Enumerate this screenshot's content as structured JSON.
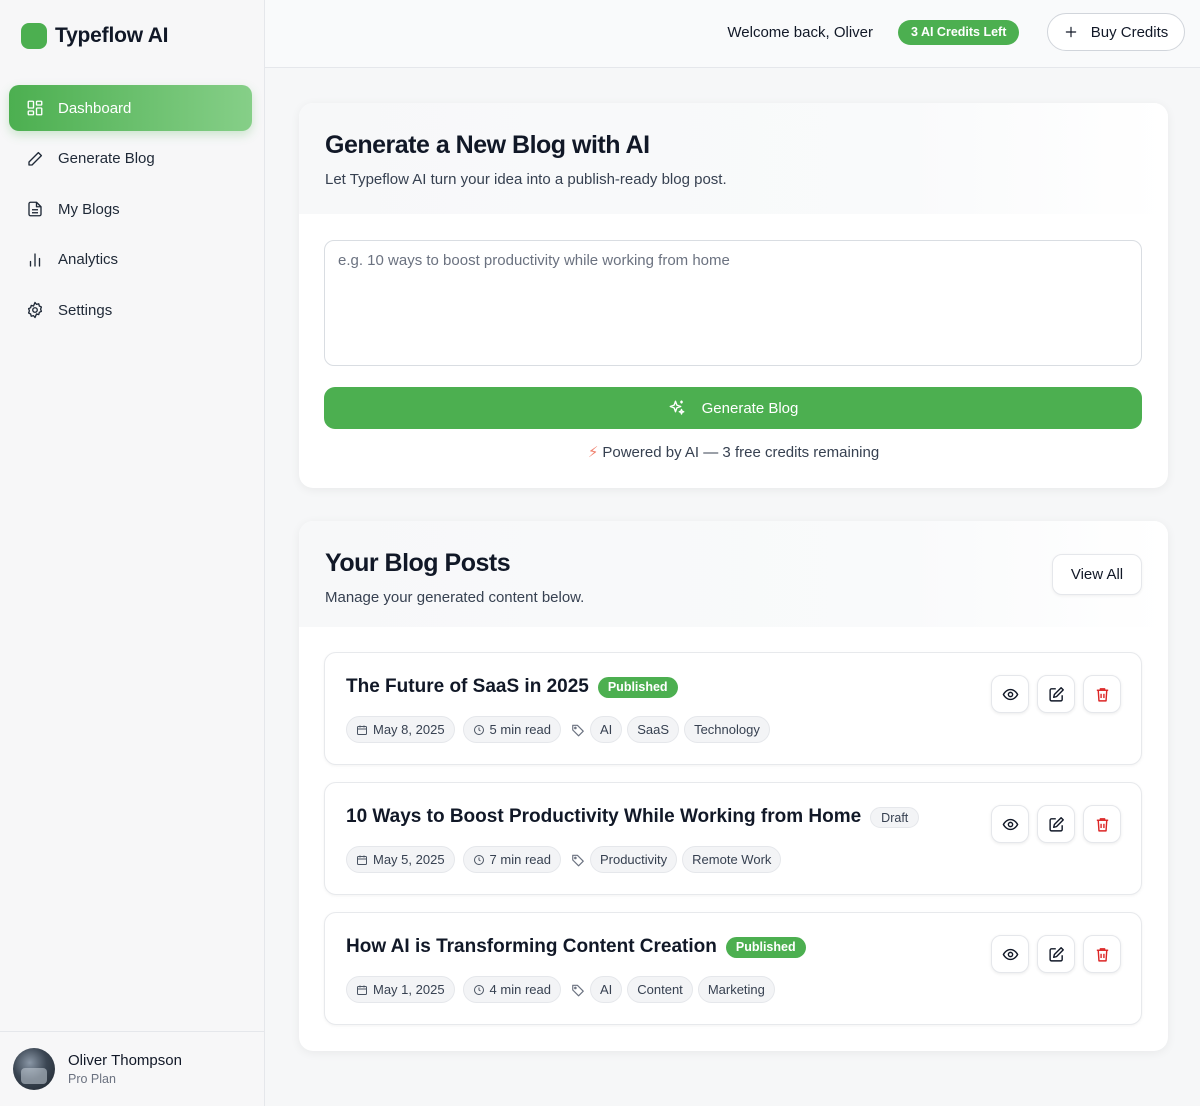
{
  "brand": {
    "name": "Typeflow AI",
    "accent": "#4caf50"
  },
  "sidebar": {
    "items": [
      {
        "label": "Dashboard",
        "icon": "dashboard-icon",
        "active": true
      },
      {
        "label": "Generate Blog",
        "icon": "pencil-icon",
        "active": false
      },
      {
        "label": "My Blogs",
        "icon": "document-icon",
        "active": false
      },
      {
        "label": "Analytics",
        "icon": "bar-chart-icon",
        "active": false
      },
      {
        "label": "Settings",
        "icon": "gear-icon",
        "active": false
      }
    ]
  },
  "user": {
    "name": "Oliver Thompson",
    "plan": "Pro Plan"
  },
  "header": {
    "welcome": "Welcome back, Oliver",
    "credits_badge": "3 AI Credits Left",
    "buy_label": "Buy Credits"
  },
  "generator": {
    "title": "Generate a New Blog with AI",
    "subtitle": "Let Typeflow AI turn your idea into a publish-ready blog post.",
    "placeholder": "e.g. 10 ways to boost productivity while working from home",
    "value": "",
    "button_label": "Generate Blog",
    "powered_text": "Powered by AI — 3 free credits remaining"
  },
  "posts": {
    "title": "Your Blog Posts",
    "subtitle": "Manage your generated content below.",
    "view_all_label": "View All",
    "items": [
      {
        "title": "The Future of SaaS in 2025",
        "status": "Published",
        "date": "May 8, 2025",
        "read_time": "5 min read",
        "tags": [
          "AI",
          "SaaS",
          "Technology"
        ]
      },
      {
        "title": "10 Ways to Boost Productivity While Working from Home",
        "status": "Draft",
        "date": "May 5, 2025",
        "read_time": "7 min read",
        "tags": [
          "Productivity",
          "Remote Work"
        ]
      },
      {
        "title": "How AI is Transforming Content Creation",
        "status": "Published",
        "date": "May 1, 2025",
        "read_time": "4 min read",
        "tags": [
          "AI",
          "Content",
          "Marketing"
        ]
      }
    ]
  },
  "colors": {
    "danger": "#dc2626",
    "muted": "#6b7280"
  }
}
